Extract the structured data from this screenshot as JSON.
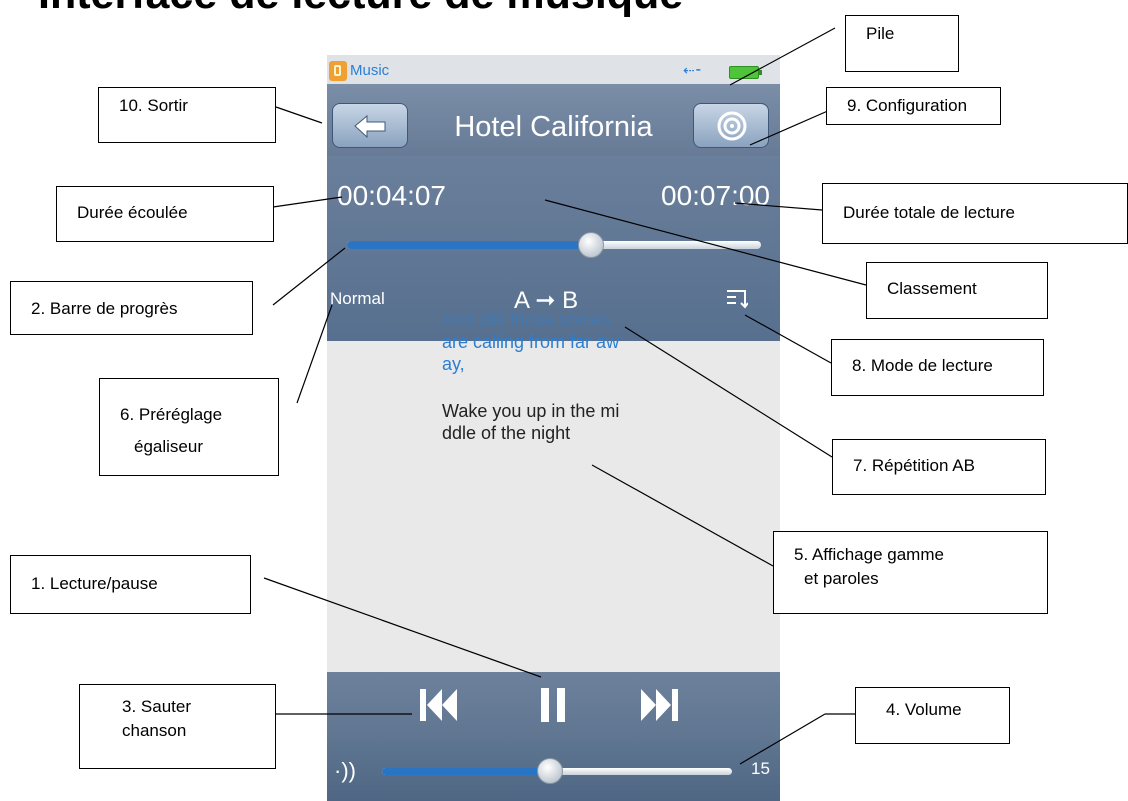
{
  "title": "Interface de lecture de musique",
  "device": {
    "app_name": "Music",
    "usb_icon": "usb-icon",
    "battery_icon": "battery-icon",
    "song_title": "Hotel California",
    "elapsed": "00:04:07",
    "total": "00:07:00",
    "progress_fraction": 0.59,
    "eq_preset": "Normal",
    "ab_repeat": "A ➞ B",
    "lyrics": [
      "And still those voices",
      "are calling from far aw",
      "ay,",
      "Wake you up in the mi",
      "ddle of the night"
    ],
    "volume": "15",
    "volume_fraction": 0.48
  },
  "labels": {
    "pile": "Pile",
    "sortir": "10. Sortir",
    "configuration": "9. Configuration",
    "duree_ecoulee": "Durée écoulée",
    "duree_totale": "Durée totale de lecture",
    "classement": "Classement",
    "barre": "2. Barre de progrès",
    "mode": "8. Mode de lecture",
    "preglage_1": "6. Préréglage",
    "preglage_2": "égaliseur",
    "repetition": "7. Répétition AB",
    "affichage_1": "5. Affichage gamme",
    "affichage_2": "et paroles",
    "lecture": "1. Lecture/pause",
    "sauter_1": "3. Sauter",
    "sauter_2": "chanson",
    "volume": "4. Volume"
  },
  "colors": {
    "accent_blue": "#2a7fd4",
    "panel": "#6a7f9b",
    "battery": "#4fc43a"
  }
}
